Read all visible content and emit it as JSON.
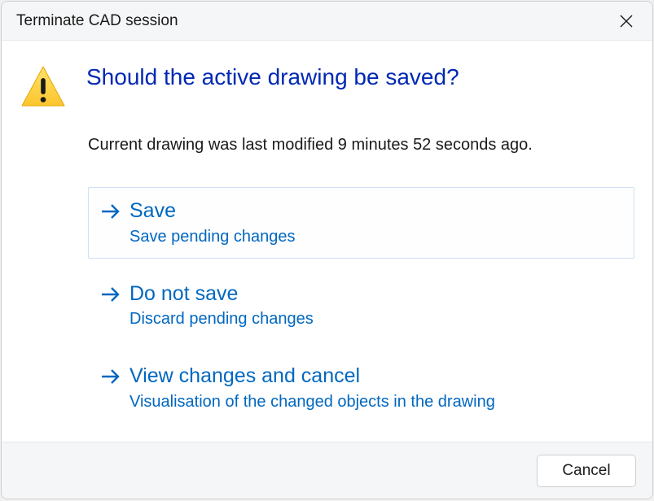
{
  "titlebar": {
    "title": "Terminate CAD session"
  },
  "dialog": {
    "heading": "Should the active drawing be saved?",
    "subtext": "Current drawing was last modified 9 minutes 52 seconds ago."
  },
  "options": [
    {
      "title": "Save",
      "desc": "Save pending changes",
      "selected": true
    },
    {
      "title": "Do not save",
      "desc": "Discard pending changes",
      "selected": false
    },
    {
      "title": "View changes and cancel",
      "desc": "Visualisation of the changed objects in the drawing",
      "selected": false
    }
  ],
  "footer": {
    "cancel_label": "Cancel"
  }
}
